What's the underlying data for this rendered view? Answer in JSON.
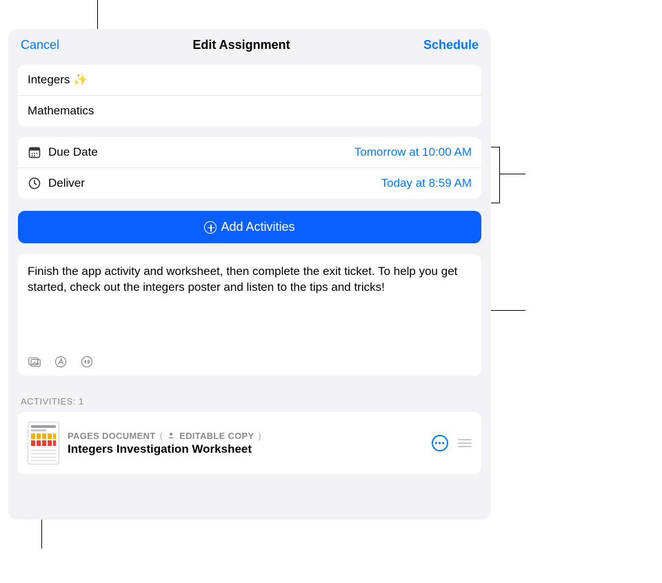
{
  "header": {
    "cancel_label": "Cancel",
    "title": "Edit Assignment",
    "schedule_label": "Schedule"
  },
  "assignment": {
    "title": "Integers ✨",
    "subject": "Mathematics"
  },
  "due": {
    "label": "Due Date",
    "value": "Tomorrow at 10:00 AM"
  },
  "deliver": {
    "label": "Deliver",
    "value": "Today at 8:59 AM"
  },
  "add_activities_label": "Add Activities",
  "instructions": "Finish the app activity and worksheet, then complete the exit ticket. To help you get started, check out the integers poster and listen to the tips and tricks!",
  "activities_header": "ACTIVITIES: 1",
  "activity": {
    "type_label": "PAGES DOCUMENT",
    "badge_label": "EDITABLE COPY",
    "title": "Integers Investigation Worksheet"
  }
}
